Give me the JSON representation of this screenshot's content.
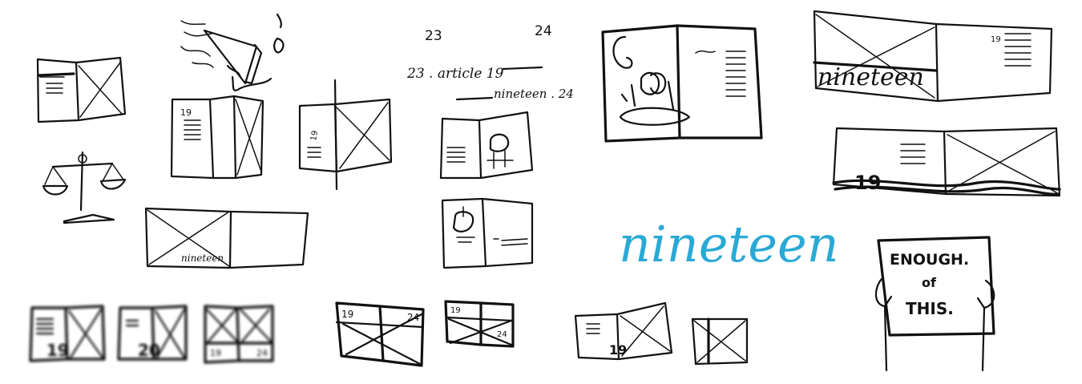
{
  "sheet": {
    "top_numbers": {
      "left": "23",
      "right": "24"
    },
    "article_line": "23 . article 19",
    "nineteen_line": "nineteen . 24",
    "big_script": "nineteen",
    "sign": {
      "line1": "ENOUGH.",
      "line2": "of",
      "line3": "THIS."
    },
    "spread_labels": {
      "page_19": "19",
      "page_20": "20",
      "page_24": "24",
      "page_23": "23",
      "nineteen_small": "nineteen",
      "nineteen_banner": "nineteen",
      "num_19_large": "19"
    }
  },
  "colors": {
    "ink": "#111111",
    "accent": "#2aa9d6",
    "paper": "#ffffff"
  }
}
